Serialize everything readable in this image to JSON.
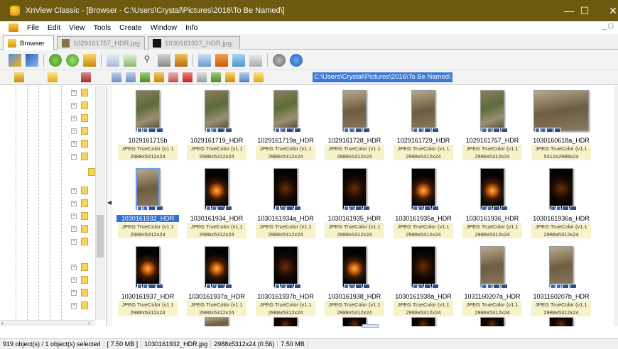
{
  "window": {
    "title": "XnView Classic - [Browser - C:\\Users\\Crystal\\Pictures\\2016\\To Be Named\\]",
    "minimize": "—",
    "maximize": "☐",
    "close": "✕"
  },
  "menu": {
    "items": [
      "File",
      "Edit",
      "View",
      "Tools",
      "Create",
      "Window",
      "Info"
    ],
    "mdi_controls": "_ ☐"
  },
  "tabs": [
    {
      "label": "Browser",
      "icon": "browser-icon"
    },
    {
      "label": "1029161757_HDR.jpg",
      "icon": "image-icon"
    },
    {
      "label": "1030161937_HDR.jpg",
      "icon": "image-icon"
    }
  ],
  "address": {
    "path": "C:\\Users\\Crystal\\Pictures\\2016\\To Be Named\\"
  },
  "thumbnails": [
    {
      "name": "1029161715b",
      "info": "JPEG TrueColor (v1.1",
      "dims": "2988x5312x24",
      "style": "photo"
    },
    {
      "name": "1029161719_HDR",
      "info": "JPEG TrueColor (v1.1",
      "dims": "2988x5312x24",
      "style": "photo"
    },
    {
      "name": "1029161719a_HDR",
      "info": "JPEG TrueColor (v1.1",
      "dims": "2988x5312x24",
      "style": "photo"
    },
    {
      "name": "1029161728_HDR",
      "info": "JPEG TrueColor (v1.1",
      "dims": "2988x5312x24",
      "style": "photo2"
    },
    {
      "name": "1029161729_HDR",
      "info": "JPEG TrueColor (v1.1",
      "dims": "2988x5312x24",
      "style": "photo2"
    },
    {
      "name": "1029161757_HDR",
      "info": "JPEG TrueColor (v1.1",
      "dims": "2988x5312x24",
      "style": "photo"
    },
    {
      "name": "1030160618a_HDR",
      "info": "JPEG TrueColor (v1.1",
      "dims": "5312x2988x24",
      "style": "photo2"
    },
    {
      "name": "1030161932_HDR",
      "info": "JPEG TrueColor (v1.1",
      "dims": "2988x5312x24",
      "style": "photo2",
      "selected": true
    },
    {
      "name": "1030161934_HDR",
      "info": "JPEG TrueColor (v1.1",
      "dims": "2988x5312x24",
      "style": "pump"
    },
    {
      "name": "1030161934a_HDR",
      "info": "JPEG TrueColor (v1.1",
      "dims": "2988x5312x24",
      "style": "dark"
    },
    {
      "name": "1030161935_HDR",
      "info": "JPEG TrueColor (v1.1",
      "dims": "2988x5312x24",
      "style": "dark"
    },
    {
      "name": "1030161935a_HDR",
      "info": "JPEG TrueColor (v1.1",
      "dims": "2988x5312x24",
      "style": "pump"
    },
    {
      "name": "1030161936_HDR",
      "info": "JPEG TrueColor (v1.1",
      "dims": "2988x5312x24",
      "style": "pump"
    },
    {
      "name": "1030161936a_HDR",
      "info": "JPEG TrueColor (v1.1",
      "dims": "2988x5312x24",
      "style": "dark"
    },
    {
      "name": "1030161937_HDR",
      "info": "JPEG TrueColor (v1.1",
      "dims": "2988x5312x24",
      "style": "pump"
    },
    {
      "name": "1030161937a_HDR",
      "info": "JPEG TrueColor (v1.1",
      "dims": "2988x5312x24",
      "style": "pump"
    },
    {
      "name": "1030161937b_HDR",
      "info": "JPEG TrueColor (v1.1",
      "dims": "2988x5312x24",
      "style": "dark"
    },
    {
      "name": "1030161938_HDR",
      "info": "JPEG TrueColor (v1.1",
      "dims": "2988x5312x24",
      "style": "pump"
    },
    {
      "name": "1030161938a_HDR",
      "info": "JPEG TrueColor (v1.1",
      "dims": "2988x5312x24",
      "style": "dark"
    },
    {
      "name": "1031160207a_HDR",
      "info": "JPEG TrueColor (v1.1",
      "dims": "2988x5312x24",
      "style": "photo2"
    },
    {
      "name": "1031160207b_HDR",
      "info": "JPEG TrueColor (v1.1",
      "dims": "2988x5312x24",
      "style": "photo2"
    }
  ],
  "status": {
    "objects": "919 object(s) / 1 object(s) selected",
    "selected_size": "[ 7.50 MB ]",
    "filename": "1030161932_HDR.jpg",
    "dimensions": "2988x5312x24 (0.56)",
    "filesize": "7.50 MB"
  },
  "colors": {
    "titlebar": "#6b5a10",
    "selection": "#3072d5",
    "path_highlight": "#3b78d8",
    "info_background": "#f7f2c8"
  }
}
